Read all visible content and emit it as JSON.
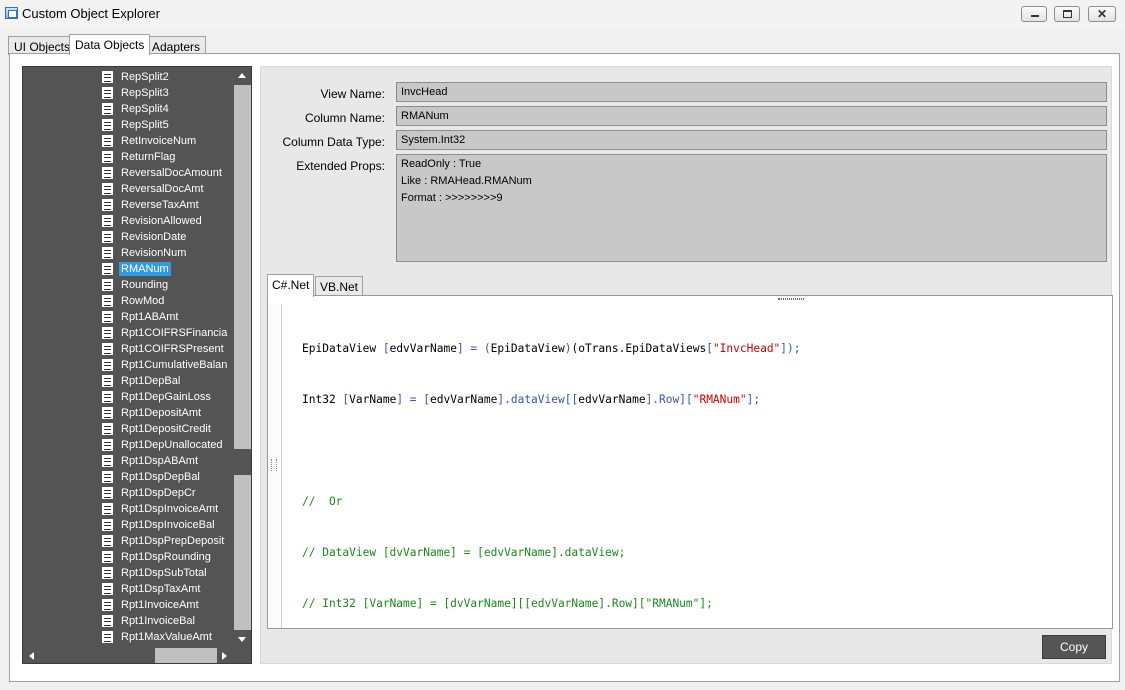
{
  "window": {
    "title": "Custom Object Explorer"
  },
  "top_tabs": [
    {
      "label": "UI Objects",
      "active": false
    },
    {
      "label": "Data Objects",
      "active": true
    },
    {
      "label": "Adapters",
      "active": false
    }
  ],
  "tree": {
    "items": [
      "RepSplit2",
      "RepSplit3",
      "RepSplit4",
      "RepSplit5",
      "RetInvoiceNum",
      "ReturnFlag",
      "ReversalDocAmount",
      "ReversalDocAmt",
      "ReverseTaxAmt",
      "RevisionAllowed",
      "RevisionDate",
      "RevisionNum",
      "RMANum",
      "Rounding",
      "RowMod",
      "Rpt1ABAmt",
      "Rpt1COIFRSFinancia",
      "Rpt1COIFRSPresent",
      "Rpt1CumulativeBalan",
      "Rpt1DepBal",
      "Rpt1DepGainLoss",
      "Rpt1DepositAmt",
      "Rpt1DepositCredit",
      "Rpt1DepUnallocated",
      "Rpt1DspABAmt",
      "Rpt1DspDepBal",
      "Rpt1DspDepCr",
      "Rpt1DspInvoiceAmt",
      "Rpt1DspInvoiceBal",
      "Rpt1DspPrepDeposit",
      "Rpt1DspRounding",
      "Rpt1DspSubTotal",
      "Rpt1DspTaxAmt",
      "Rpt1InvoiceAmt",
      "Rpt1InvoiceBal",
      "Rpt1MaxValueAmt"
    ],
    "selected": "RMANum"
  },
  "details": {
    "view_name_label": "View Name:",
    "view_name": "InvcHead",
    "column_name_label": "Column Name:",
    "column_name": "RMANum",
    "column_type_label": "Column Data Type:",
    "column_type": "System.Int32",
    "ext_props_label": "Extended Props:",
    "ext_props": [
      "ReadOnly : True",
      "Like : RMAHead.RMANum",
      "Format : >>>>>>>>9"
    ]
  },
  "code_tabs": [
    {
      "label": "C#.Net",
      "active": true
    },
    {
      "label": "VB.Net",
      "active": false
    }
  ],
  "code": {
    "line1": {
      "a": "EpiDataView ",
      "b": "[",
      "c": "edvVarName",
      "d": "] = (",
      "e": "EpiDataView",
      "f": ")",
      "g": "(oTrans.EpiDataViews",
      "h": "[",
      "i": "\"InvcHead\"",
      "j": "]);"
    },
    "line2": {
      "a": "Int32 ",
      "b": "[",
      "c": "VarName",
      "d": "] = [",
      "e": "edvVarName",
      "f": "].dataView[[",
      "g": "edvVarName",
      "h": "].Row][",
      "i": "\"RMANum\"",
      "j": "];"
    },
    "line3": "",
    "line4": "//  Or",
    "line5": "// DataView [dvVarName] = [edvVarName].dataView;",
    "line6": "// Int32 [VarName] = [dvVarName][[edvVarName].Row][\"RMANum\"];"
  },
  "copy_button": "Copy",
  "colors": {
    "tree_bg": "#545454",
    "selected": "#3399dd",
    "string": "#cc0000",
    "comment": "#1a8a1a",
    "button": "#555555"
  }
}
